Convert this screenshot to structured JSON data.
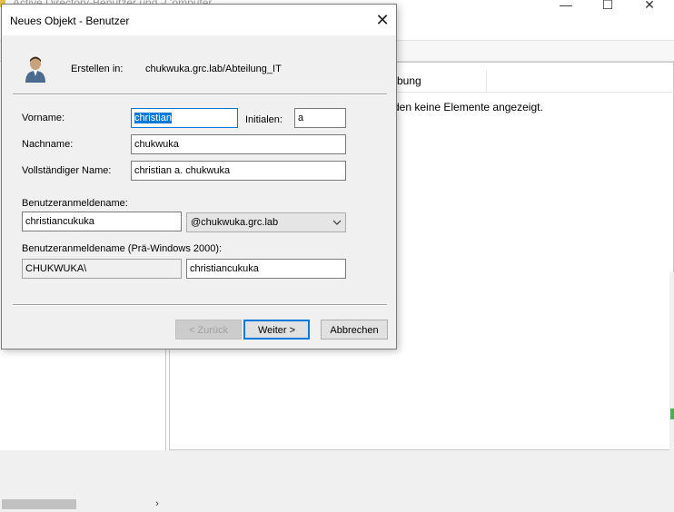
{
  "background_window": {
    "title": "Active Directory-Benutzer und -Computer",
    "minimize_glyph": "—",
    "maximize_glyph": "☐",
    "close_glyph": "✕",
    "column_description": "bung",
    "empty_message": "den keine Elemente angezeigt.",
    "scroll_arrow": "›"
  },
  "dialog": {
    "title": "Neues Objekt - Benutzer",
    "close_glyph": "✕",
    "create_in_label": "Erstellen in:",
    "create_in_path": "chukwuka.grc.lab/Abteilung_IT",
    "icon": "user-icon"
  },
  "form": {
    "first_name_label": "Vorname:",
    "first_name_value": "christian",
    "initials_label": "Initialen:",
    "initials_value": "a",
    "last_name_label": "Nachname:",
    "last_name_value": "chukwuka",
    "full_name_label": "Vollständiger Name:",
    "full_name_value": "christian a. chukwuka",
    "logon_name_label": "Benutzeranmeldename:",
    "logon_name_value": "christiancukuka",
    "upn_suffix_value": "@chukwuka.grc.lab",
    "pre2000_label": "Benutzeranmeldename (Prä-Windows 2000):",
    "pre2000_domain_value": "CHUKWUKA\\",
    "pre2000_name_value": "christiancukuka"
  },
  "buttons": {
    "back_label": "< Zurück",
    "next_label": "Weiter >",
    "cancel_label": "Abbrechen"
  },
  "colors": {
    "accent": "#0078d7",
    "dialog_bg": "#f0f0f0"
  }
}
